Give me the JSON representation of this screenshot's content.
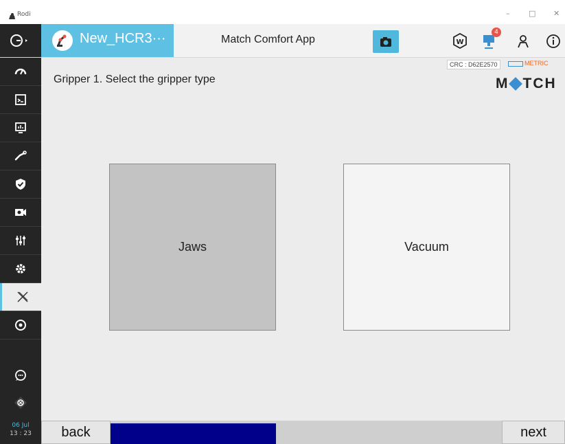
{
  "window": {
    "title": "Rodi",
    "minimize": "–",
    "maximize": "□",
    "close": "✕"
  },
  "topbar": {
    "project_name": "New_HCR3···",
    "app_title": "Match Comfort App",
    "notification_count": "4"
  },
  "status": {
    "crc": "CRC : D62E2570",
    "units": "METRIC"
  },
  "logo": {
    "left": "M",
    "right": "TCH"
  },
  "main": {
    "heading": "Gripper 1. Select the gripper type",
    "options": [
      {
        "label": "Jaws",
        "selected": true
      },
      {
        "label": "Vacuum",
        "selected": false
      }
    ]
  },
  "footer": {
    "back": "back",
    "next": "next",
    "progress": 0.3
  },
  "datetime": {
    "date": "06 Jul",
    "time": "13 : 23"
  },
  "colors": {
    "accent": "#5ec1e3",
    "sidebar": "#252525",
    "progress": "#00008b",
    "logo_accent": "#3b8fd0",
    "badge": "#e8534a"
  }
}
